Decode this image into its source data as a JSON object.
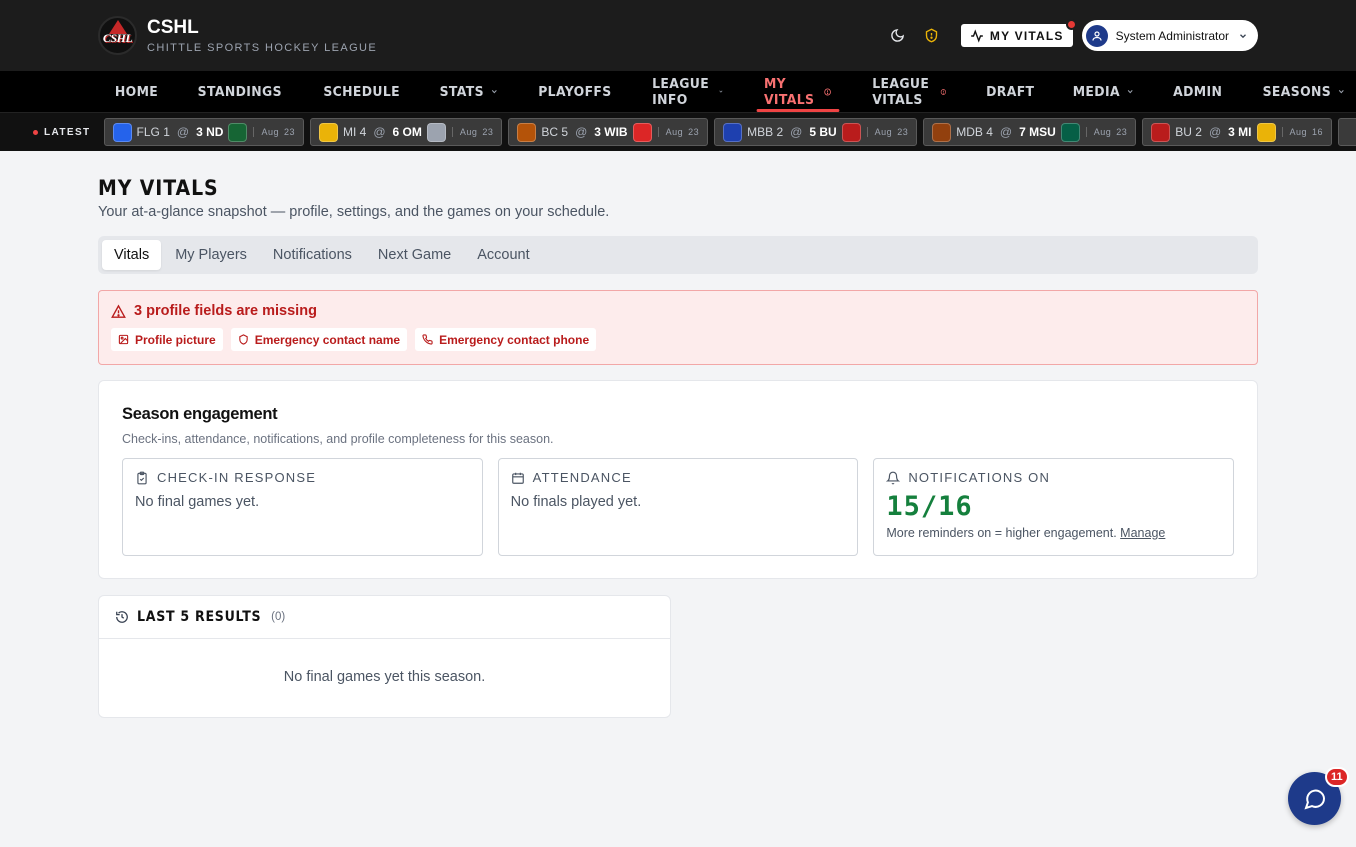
{
  "header": {
    "logo_text": "CSHL",
    "brand_name": "CSHL",
    "brand_subtitle": "CHITTLE SPORTS HOCKEY LEAGUE",
    "vitals_button": "MY VITALS",
    "user_name": "System Administrator"
  },
  "nav": {
    "home": "HOME",
    "standings": "STANDINGS",
    "schedule": "SCHEDULE",
    "stats": "STATS",
    "playoffs": "PLAYOFFS",
    "league_info": "LEAGUE INFO",
    "my_vitals": "MY VITALS",
    "league_vitals": "LEAGUE VITALS",
    "draft": "DRAFT",
    "media": "MEDIA",
    "admin": "ADMIN",
    "seasons": "SEASONS"
  },
  "ticker": {
    "label": "LATEST",
    "games": [
      {
        "away": "FLG 1",
        "home": "3 ND",
        "month": "Aug",
        "day": "23",
        "away_color": "#2563eb",
        "home_color": "#166534"
      },
      {
        "away": "MI 4",
        "home": "6 OM",
        "month": "Aug",
        "day": "23",
        "away_color": "#eab308",
        "home_color": "#9ca3af"
      },
      {
        "away": "BC 5",
        "home": "3 WIB",
        "month": "Aug",
        "day": "23",
        "away_color": "#b45309",
        "home_color": "#dc2626"
      },
      {
        "away": "MBB 2",
        "home": "5 BU",
        "month": "Aug",
        "day": "23",
        "away_color": "#1e40af",
        "home_color": "#b91c1c"
      },
      {
        "away": "MDB 4",
        "home": "7 MSU",
        "month": "Aug",
        "day": "23",
        "away_color": "#92400e",
        "home_color": "#065f46"
      },
      {
        "away": "BU 2",
        "home": "3 MI",
        "month": "Aug",
        "day": "16",
        "away_color": "#b91c1c",
        "home_color": "#eab308"
      }
    ],
    "separator": "@"
  },
  "page": {
    "title": "MY VITALS",
    "subtitle": "Your at-a-glance snapshot — profile, settings, and the games on your schedule."
  },
  "tabs": [
    "Vitals",
    "My Players",
    "Notifications",
    "Next Game",
    "Account"
  ],
  "alert": {
    "title": "3 profile fields are missing",
    "chips": [
      "Profile picture",
      "Emergency contact name",
      "Emergency contact phone"
    ]
  },
  "engagement": {
    "title": "Season engagement",
    "subtitle": "Check-ins, attendance, notifications, and profile completeness for this season.",
    "checkin": {
      "label": "CHECK-IN RESPONSE",
      "body": "No final games yet."
    },
    "attendance": {
      "label": "ATTENDANCE",
      "body": "No finals played yet."
    },
    "notifications": {
      "label": "NOTIFICATIONS ON",
      "value": "15/16",
      "note": "More reminders on = higher engagement.",
      "link": "Manage"
    }
  },
  "results": {
    "title": "LAST 5 RESULTS",
    "count": "(0)",
    "empty": "No final games yet this season."
  },
  "chat": {
    "badge": "11"
  },
  "colors": {
    "accent_red": "#ef4444",
    "success_green": "#15803d",
    "navy": "#1e3a8a"
  }
}
